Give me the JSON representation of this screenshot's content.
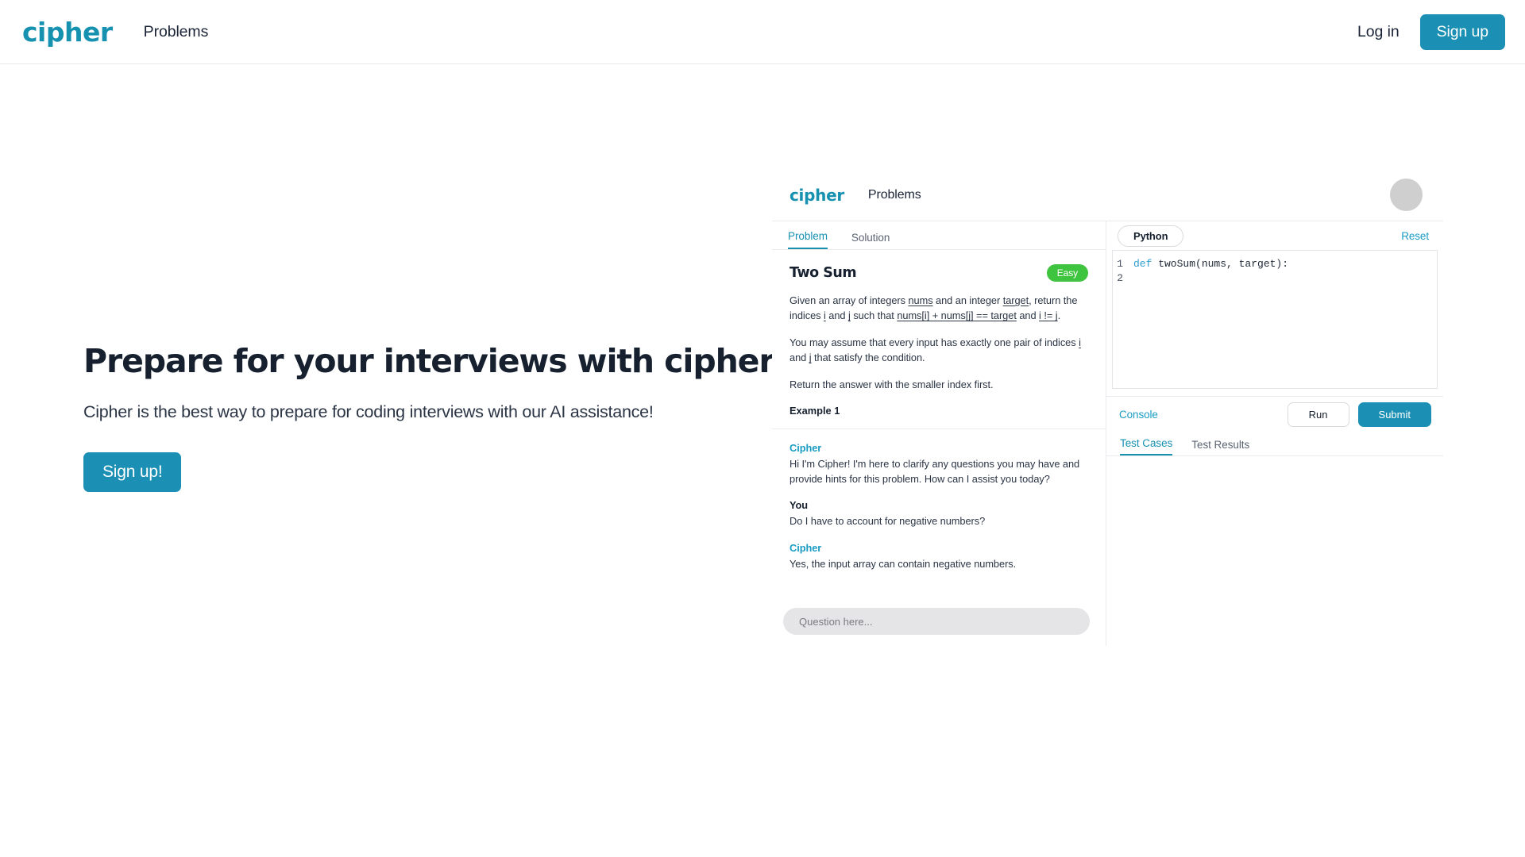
{
  "site": {
    "brand": "cipher",
    "nav": {
      "problems": "Problems"
    },
    "auth": {
      "login": "Log in",
      "signup": "Sign up"
    },
    "accent_color": "#1b90b4",
    "brand_color": "#1691b0"
  },
  "hero": {
    "title": "Prepare for your interviews with cipher",
    "subtitle": "Cipher is the best way to prepare for coding interviews with our AI assistance!",
    "cta": "Sign up!"
  },
  "app": {
    "brand": "cipher",
    "nav": {
      "problems": "Problems"
    },
    "avatar": "avatar-placeholder",
    "tabs": [
      {
        "label": "Problem",
        "active": true
      },
      {
        "label": "Solution",
        "active": false
      }
    ],
    "problem": {
      "title": "Two Sum",
      "difficulty": "Easy",
      "difficulty_color": "#3fc43f",
      "paragraph1_parts": [
        {
          "text": "Given an array of integers ",
          "code": false
        },
        {
          "text": "nums",
          "code": true
        },
        {
          "text": " and an integer ",
          "code": false
        },
        {
          "text": "target",
          "code": true
        },
        {
          "text": ", return the indices ",
          "code": false
        },
        {
          "text": "i",
          "code": true
        },
        {
          "text": " and ",
          "code": false
        },
        {
          "text": "j",
          "code": true
        },
        {
          "text": " such that ",
          "code": false
        },
        {
          "text": "nums[i] + nums[j] == target",
          "code": true
        },
        {
          "text": " and ",
          "code": false
        },
        {
          "text": "i != j",
          "code": true
        },
        {
          "text": ".",
          "code": false
        }
      ],
      "paragraph2_parts": [
        {
          "text": "You may assume that every input has exactly one pair of indices ",
          "code": false
        },
        {
          "text": "i",
          "code": true
        },
        {
          "text": " and ",
          "code": false
        },
        {
          "text": "j",
          "code": true
        },
        {
          "text": " that satisfy the condition.",
          "code": false
        }
      ],
      "paragraph3": "Return the answer with the smaller index first.",
      "example_label": "Example 1"
    },
    "chat": {
      "messages": [
        {
          "author": "Cipher",
          "role": "bot",
          "text": "Hi I'm Cipher! I'm here to clarify any questions you may have and provide hints for this problem. How can I assist you today?"
        },
        {
          "author": "You",
          "role": "user",
          "text": "Do I have to account for negative numbers?"
        },
        {
          "author": "Cipher",
          "role": "bot",
          "text": "Yes, the input array can contain negative numbers."
        }
      ],
      "input_placeholder": "Question here...",
      "input_value": ""
    },
    "editor": {
      "language": "Python",
      "reset_label": "Reset",
      "lines": [
        {
          "number": "1",
          "keyword": "def",
          "rest": " twoSum(nums, target):"
        },
        {
          "number": "2",
          "keyword": "",
          "rest": ""
        }
      ]
    },
    "console": {
      "label": "Console",
      "run_label": "Run",
      "submit_label": "Submit",
      "tabs": [
        {
          "label": "Test Cases",
          "active": true
        },
        {
          "label": "Test Results",
          "active": false
        }
      ]
    }
  }
}
